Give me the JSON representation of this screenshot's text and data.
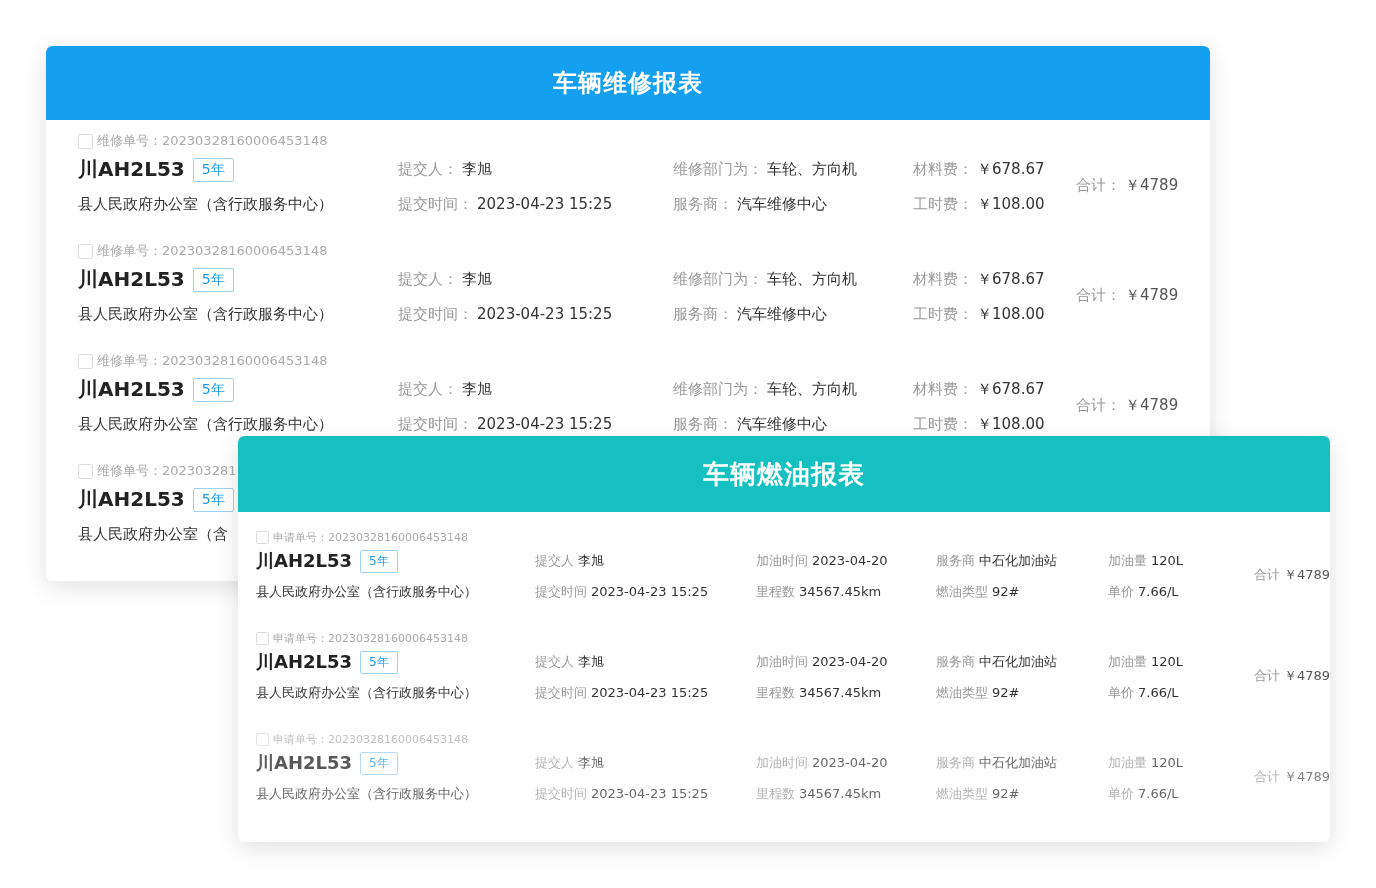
{
  "repair_report": {
    "title": "车辆维修报表",
    "rows": [
      {
        "checked": false,
        "order_label": "维修单号：",
        "order_no": "20230328160006453148",
        "plate": "川AH2L53",
        "tag": "5年",
        "org": "县人民政府办公室（含行政服务中心）",
        "fields": [
          {
            "label": "提交人：",
            "value": "李旭"
          },
          {
            "label": "维修部门为：",
            "value": "车轮、方向机"
          },
          {
            "label": "材料费：",
            "value": "￥678.67"
          },
          {
            "label": "提交时间：",
            "value": "2023-04-23 15:25"
          },
          {
            "label": "服务商：",
            "value": "汽车维修中心"
          },
          {
            "label": "工时费：",
            "value": "￥108.00"
          }
        ],
        "total": {
          "label": "合计：",
          "value": "￥4789"
        }
      },
      {
        "checked": false,
        "order_label": "维修单号：",
        "order_no": "20230328160006453148",
        "plate": "川AH2L53",
        "tag": "5年",
        "org": "县人民政府办公室（含行政服务中心）",
        "fields": [
          {
            "label": "提交人：",
            "value": "李旭"
          },
          {
            "label": "维修部门为：",
            "value": "车轮、方向机"
          },
          {
            "label": "材料费：",
            "value": "￥678.67"
          },
          {
            "label": "提交时间：",
            "value": "2023-04-23 15:25"
          },
          {
            "label": "服务商：",
            "value": "汽车维修中心"
          },
          {
            "label": "工时费：",
            "value": "￥108.00"
          }
        ],
        "total": {
          "label": "合计：",
          "value": "￥4789"
        }
      },
      {
        "checked": false,
        "order_label": "维修单号：",
        "order_no": "20230328160006453148",
        "plate": "川AH2L53",
        "tag": "5年",
        "org": "县人民政府办公室（含行政服务中心）",
        "fields": [
          {
            "label": "提交人：",
            "value": "李旭"
          },
          {
            "label": "维修部门为：",
            "value": "车轮、方向机"
          },
          {
            "label": "材料费：",
            "value": "￥678.67"
          },
          {
            "label": "提交时间：",
            "value": "2023-04-23 15:25"
          },
          {
            "label": "服务商：",
            "value": "汽车维修中心"
          },
          {
            "label": "工时费：",
            "value": "￥108.00"
          }
        ],
        "total": {
          "label": "合计：",
          "value": "￥4789"
        }
      },
      {
        "checked": false,
        "order_label": "维修单号：",
        "order_no": "202303281",
        "plate": "川AH2L53",
        "tag": "5年",
        "org": "县人民政府办公室（含"
      }
    ]
  },
  "fuel_report": {
    "title": "车辆燃油报表",
    "rows": [
      {
        "checked": false,
        "faded": false,
        "order_label": "申请单号：",
        "order_no": "20230328160006453148",
        "plate": "川AH2L53",
        "tag": "5年",
        "org": "县人民政府办公室（含行政服务中心）",
        "fields": [
          {
            "label": "提交人",
            "value": "李旭"
          },
          {
            "label": "加油时间",
            "value": "2023-04-20"
          },
          {
            "label": "服务商",
            "value": "中石化加油站"
          },
          {
            "label": "加油量",
            "value": "120L"
          },
          {
            "label": "提交时间",
            "value": "2023-04-23 15:25"
          },
          {
            "label": "里程数",
            "value": "34567.45km"
          },
          {
            "label": "燃油类型",
            "value": "92#"
          },
          {
            "label": "单价",
            "value": "7.66/L"
          }
        ],
        "total": {
          "label": "合计",
          "value": "￥4789"
        }
      },
      {
        "checked": false,
        "faded": false,
        "order_label": "申请单号：",
        "order_no": "20230328160006453148",
        "plate": "川AH2L53",
        "tag": "5年",
        "org": "县人民政府办公室（含行政服务中心）",
        "fields": [
          {
            "label": "提交人",
            "value": "李旭"
          },
          {
            "label": "加油时间",
            "value": "2023-04-20"
          },
          {
            "label": "服务商",
            "value": "中石化加油站"
          },
          {
            "label": "加油量",
            "value": "120L"
          },
          {
            "label": "提交时间",
            "value": "2023-04-23 15:25"
          },
          {
            "label": "里程数",
            "value": "34567.45km"
          },
          {
            "label": "燃油类型",
            "value": "92#"
          },
          {
            "label": "单价",
            "value": "7.66/L"
          }
        ],
        "total": {
          "label": "合计",
          "value": "￥4789"
        }
      },
      {
        "checked": false,
        "faded": true,
        "order_label": "申请单号：",
        "order_no": "20230328160006453148",
        "plate": "川AH2L53",
        "tag": "5年",
        "org": "县人民政府办公室（含行政服务中心）",
        "fields": [
          {
            "label": "提交人",
            "value": "李旭"
          },
          {
            "label": "加油时间",
            "value": "2023-04-20"
          },
          {
            "label": "服务商",
            "value": "中石化加油站"
          },
          {
            "label": "加油量",
            "value": "120L"
          },
          {
            "label": "提交时间",
            "value": "2023-04-23 15:25"
          },
          {
            "label": "里程数",
            "value": "34567.45km"
          },
          {
            "label": "燃油类型",
            "value": "92#"
          },
          {
            "label": "单价",
            "value": "7.66/L"
          }
        ],
        "total": {
          "label": "合计",
          "value": "￥4789"
        }
      }
    ]
  }
}
